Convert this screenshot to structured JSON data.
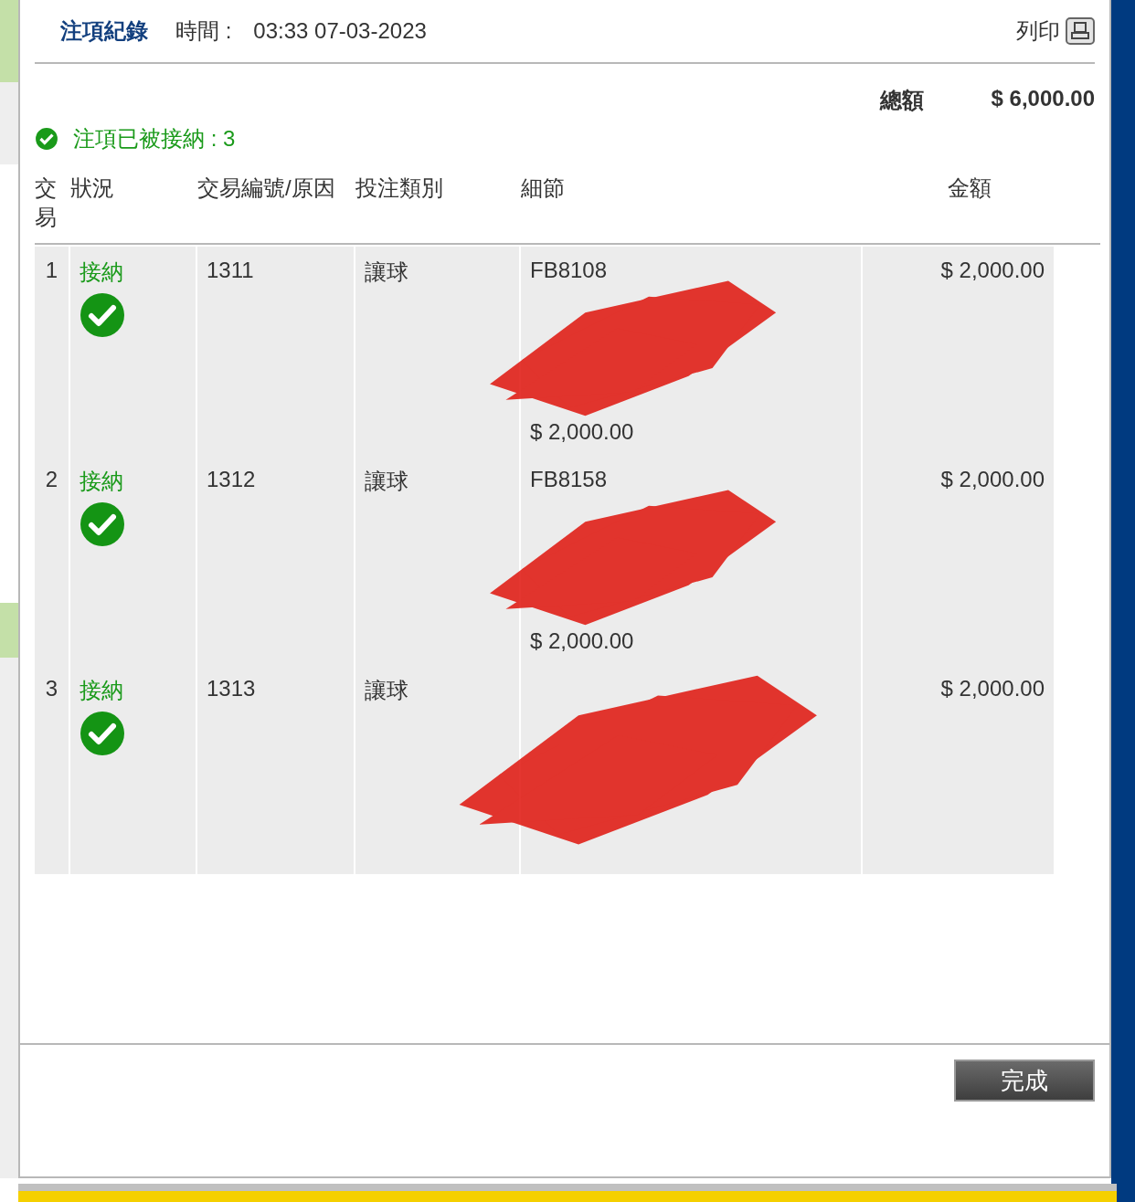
{
  "dialog": {
    "title": "注項紀錄",
    "time_label": "時間 :",
    "time": "03:33 07-03-2023",
    "print_label": "列印"
  },
  "total": {
    "label": "總額",
    "value": "$ 6,000.00"
  },
  "accepted_message": "注項已被接納 : 3",
  "table": {
    "columns": [
      "交易",
      "狀況",
      "交易編號/原因",
      "投注類別",
      "細節",
      "金額"
    ],
    "rows": [
      {
        "index": "1",
        "status": "接納",
        "accepted": true,
        "ref": "1311",
        "bet_type": "讓球",
        "detail_code": "FB8108",
        "detail_amount": "$ 2,000.00",
        "redacted": true,
        "amount": "$ 2,000.00"
      },
      {
        "index": "2",
        "status": "接納",
        "accepted": true,
        "ref": "1312",
        "bet_type": "讓球",
        "detail_code": "FB8158",
        "detail_amount": "$ 2,000.00",
        "redacted": true,
        "amount": "$ 2,000.00"
      },
      {
        "index": "3",
        "status": "接納",
        "accepted": true,
        "ref": "1313",
        "bet_type": "讓球",
        "redacted": true,
        "amount": "$ 2,000.00"
      }
    ]
  },
  "buttons": [
    "完成"
  ]
}
